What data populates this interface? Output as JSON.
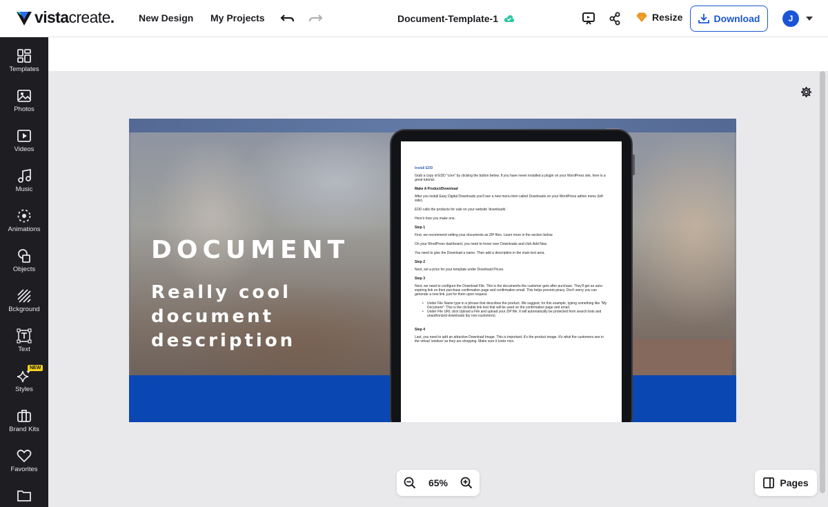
{
  "header": {
    "logo_bold": "vista",
    "logo_light": "create",
    "logo_dot": ".",
    "nav_new_design": "New Design",
    "nav_my_projects": "My Projects",
    "document_title": "Document-Template-1",
    "resize_label": "Resize",
    "download_label": "Download",
    "avatar_initial": "J"
  },
  "sidebar": {
    "items": [
      {
        "label": "Templates",
        "icon": "templates-icon"
      },
      {
        "label": "Photos",
        "icon": "photos-icon"
      },
      {
        "label": "Videos",
        "icon": "videos-icon"
      },
      {
        "label": "Music",
        "icon": "music-icon"
      },
      {
        "label": "Animations",
        "icon": "animations-icon"
      },
      {
        "label": "Objects",
        "icon": "objects-icon"
      },
      {
        "label": "Bckground",
        "icon": "background-icon"
      },
      {
        "label": "Text",
        "icon": "text-icon"
      },
      {
        "label": "Styles",
        "icon": "styles-icon"
      },
      {
        "label": "Brand Kits",
        "icon": "brand-kits-icon"
      },
      {
        "label": "Favorites",
        "icon": "favorites-icon"
      },
      {
        "label": "",
        "icon": "folder-icon"
      }
    ],
    "styles_badge": "NEW"
  },
  "design": {
    "title": "DOCUMENT",
    "subtitle_line1": "Really cool",
    "subtitle_line2": "document",
    "subtitle_line3": "description",
    "colors": {
      "blue_bar": "#0a47b3",
      "orange": "#c46a2a"
    }
  },
  "tablet_doc": {
    "heading_install": "Install EDD",
    "p_install": "Grab a copy of EDD \"core\" by clicking the button below. If you have never installed a plugin on your WordPress site, here is a great tutorial.",
    "heading_make": "Make A Product/Download",
    "p_make1": "After you install Easy Digital Downloads you'll see a new menu item called Downloads on your WordPress admin menu (left side).",
    "p_make2": "EDD calls the products for sale on your website 'downloads'.",
    "p_make3": "Here's how you make one.",
    "step1": "Step 1",
    "p_step1a": "First, we recommend setting your documents as ZIP files. Learn more in the section below.",
    "p_step1b": "On your WordPress dashboard, you need to hover over Downloads and click Add New.",
    "p_step1c": "You need to give the Download a name. Then add a description in the main text area.",
    "step2": "Step 2",
    "p_step2": "Next, set a price for your template under Download Prices.",
    "step3": "Step 3",
    "p_step3": "Next, we need to configure the Download File. This is the document/s the customer gets after purchase. They'll get an auto-expiring link on their purchase confirmation page and confirmation email. This helps prevent piracy. Don't worry you can generate a new link, just for them upon request.",
    "li_1": "Under File Name type in a phrase that describes the product. We suggest, for this example, typing something like \"My Document\". This is the clickable link text that will be used on the confirmation page and email.",
    "li_2": "Under File URL click Upload a File and upload your ZIP file. It will automatically be protected from search bots and unauthorized downloads (by non-customers).",
    "step4": "Step 4",
    "p_step4": "Last, you need to add an attractive Download Image. This is important. It's the product image. It's what the customers see in the virtual 'window' as they are shopping. Make sure it looks nice."
  },
  "zoom": {
    "value": "65%"
  },
  "pages": {
    "label": "Pages"
  }
}
